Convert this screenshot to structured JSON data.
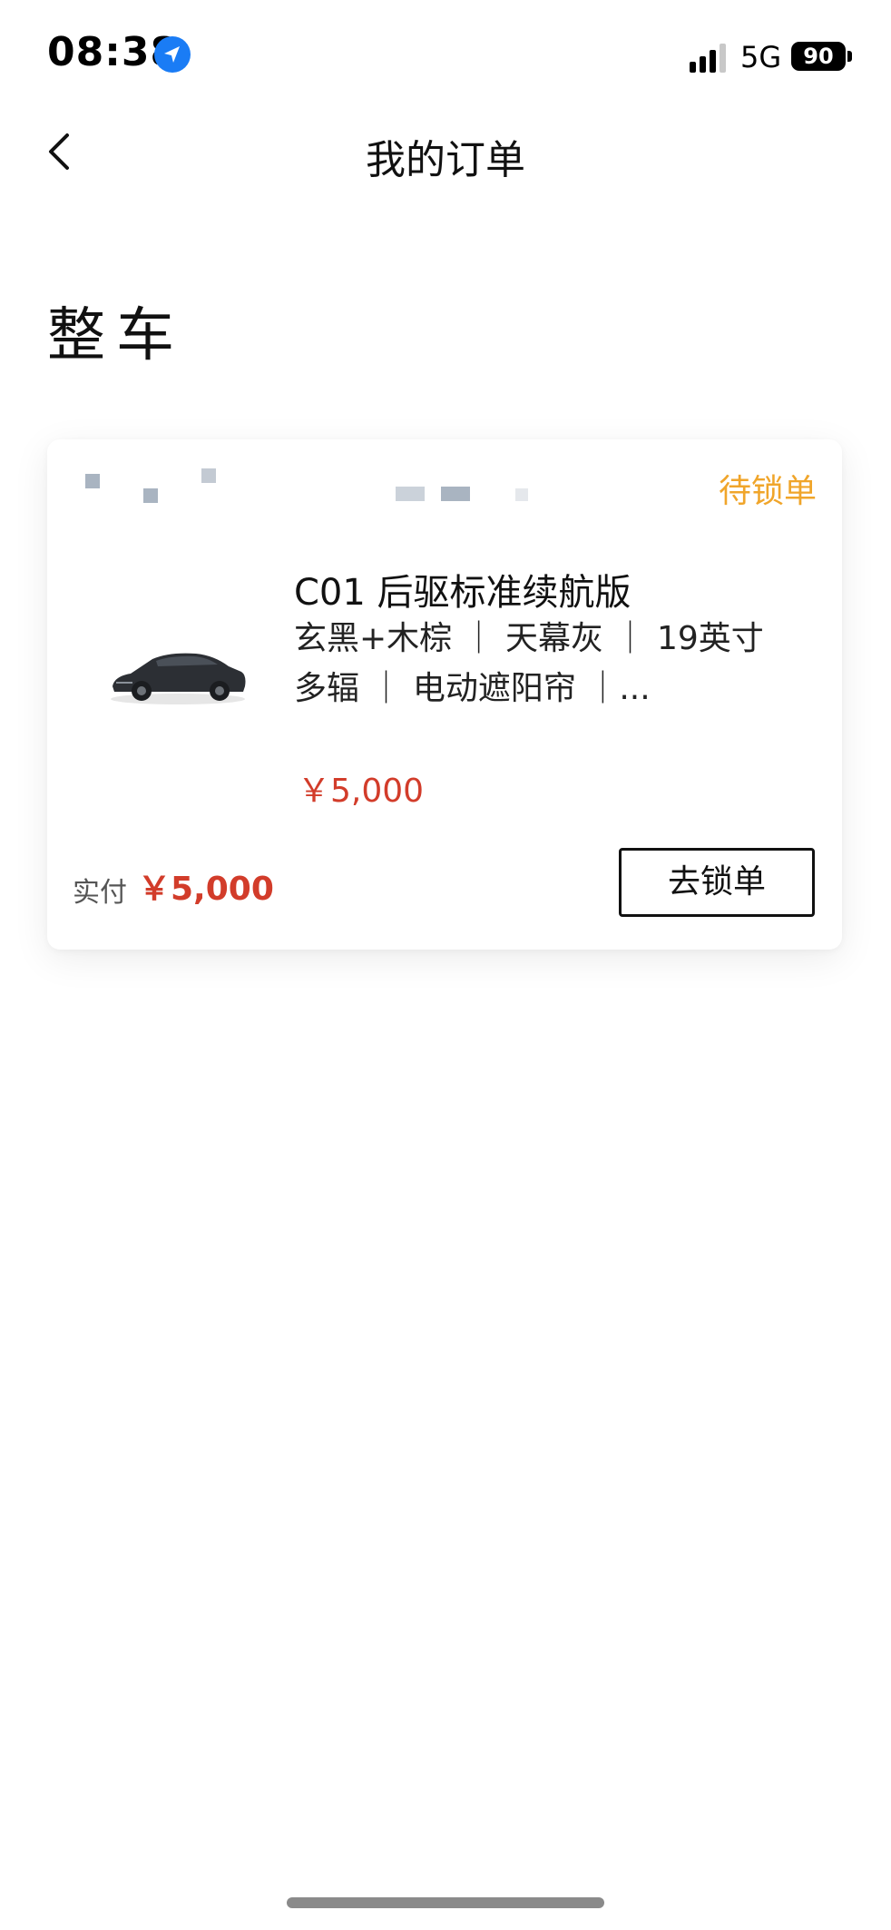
{
  "status_bar": {
    "time": "08:38",
    "network": "5G",
    "battery": "90",
    "location_icon": "location-arrow-icon",
    "signal_icon": "cellular-signal-icon"
  },
  "nav": {
    "back_icon": "chevron-left-icon",
    "title": "我的订单"
  },
  "section": {
    "title": "整车"
  },
  "order": {
    "status": "待锁单",
    "status_color": "#f0a52a",
    "product_name": "C01 后驱标准续航版",
    "options": "玄黑+木棕 ｜ 天幕灰 ｜ 19英寸多辐 ｜ 电动遮阳帘 ｜...",
    "price": "￥5,000",
    "paid_label": "实付",
    "paid_amount": "￥5,000",
    "price_color": "#d23c2a",
    "action_label": "去锁单",
    "car_image": "car-image"
  }
}
